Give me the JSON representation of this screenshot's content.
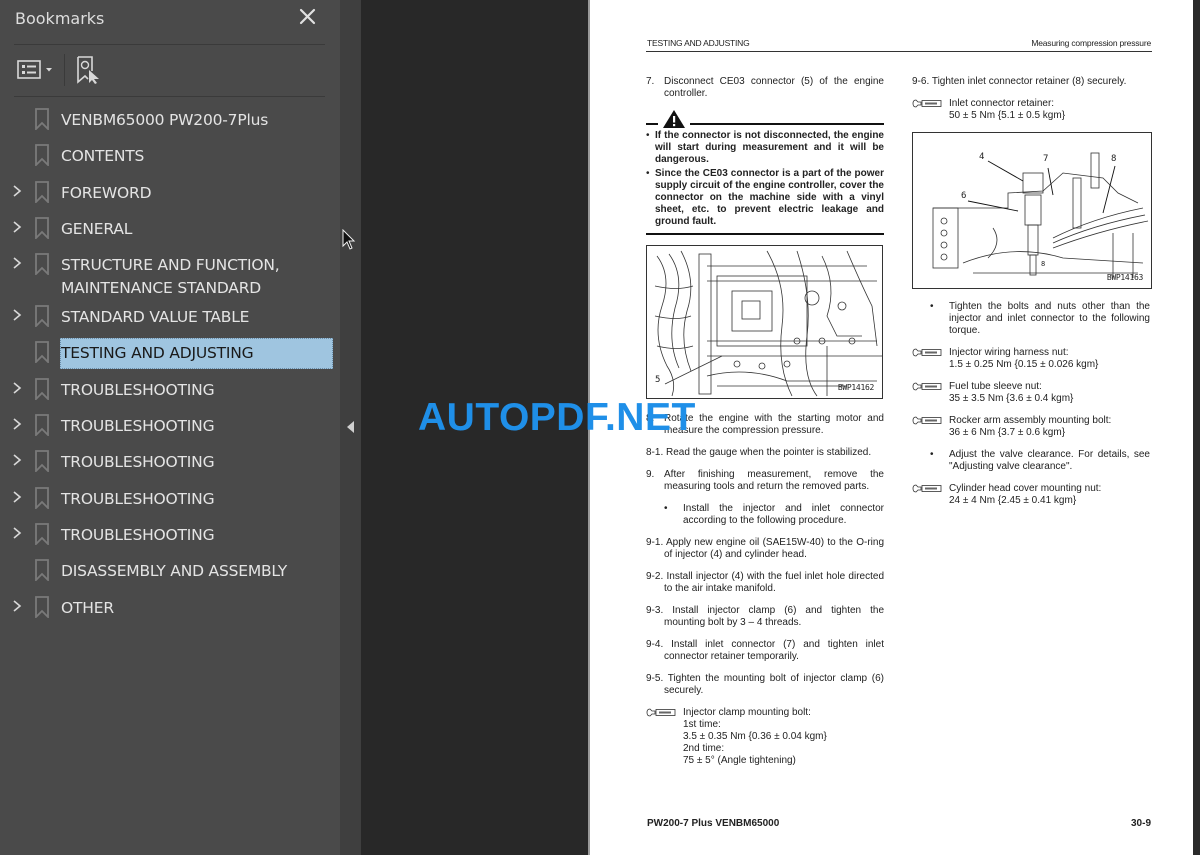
{
  "sidebar": {
    "title": "Bookmarks",
    "close_icon": "close-icon",
    "tools": {
      "options_icon": "list-options-icon",
      "find_icon": "find-current-bookmark-icon"
    },
    "items": [
      {
        "label": "VENBM65000 PW200-7Plus",
        "expandable": false,
        "selected": false
      },
      {
        "label": "CONTENTS",
        "expandable": false,
        "selected": false
      },
      {
        "label": "FOREWORD",
        "expandable": true,
        "selected": false
      },
      {
        "label": "GENERAL",
        "expandable": true,
        "selected": false
      },
      {
        "label": "STRUCTURE AND FUNCTION,",
        "label2": "MAINTENANCE STANDARD",
        "expandable": true,
        "selected": false
      },
      {
        "label": "STANDARD VALUE TABLE",
        "expandable": true,
        "selected": false
      },
      {
        "label": "TESTING AND ADJUSTING",
        "expandable": false,
        "selected": true
      },
      {
        "label": "TROUBLESHOOTING",
        "expandable": true,
        "selected": false
      },
      {
        "label": "TROUBLESHOOTING",
        "expandable": true,
        "selected": false
      },
      {
        "label": "TROUBLESHOOTING",
        "expandable": true,
        "selected": false
      },
      {
        "label": "TROUBLESHOOTING",
        "expandable": true,
        "selected": false
      },
      {
        "label": "TROUBLESHOOTING",
        "expandable": true,
        "selected": false
      },
      {
        "label": "DISASSEMBLY AND ASSEMBLY",
        "expandable": false,
        "selected": false
      },
      {
        "label": "OTHER",
        "expandable": true,
        "selected": false
      }
    ]
  },
  "watermark": "AUTOPDF.NET",
  "page": {
    "header_left": "TESTING AND ADJUSTING",
    "header_right": "Measuring compression pressure",
    "left": {
      "step7_num": "7.",
      "step7_text": "Disconnect CE03 connector (5) of the engine controller.",
      "warning": [
        "If the connector is not disconnected, the engine will start during measurement and it will be dangerous.",
        "Since the CE03 connector is a part of the power supply circuit of the engine controller, cover the connector on the machine side with a vinyl sheet, etc. to prevent electric leakage and ground fault."
      ],
      "figure1": {
        "code": "BWP14162",
        "callout": "5"
      },
      "step8_num": "8.",
      "step8_text": "Rotate the engine with the starting motor and measure the compression pressure.",
      "step8_1": "8-1. Read the gauge when the pointer is stabilized.",
      "step9_num": "9.",
      "step9_text": "After finishing measurement, remove the measuring tools and return the removed parts.",
      "step9_bullet": "Install the injector and inlet connector according to the following procedure.",
      "step9_1": "9-1. Apply new engine oil (SAE15W-40) to the O-ring of injector (4) and cylinder head.",
      "step9_2": "9-2. Install injector (4) with the fuel inlet hole directed to the air intake manifold.",
      "step9_3": "9-3. Install injector clamp (6) and tighten the mounting bolt by 3 – 4 threads.",
      "step9_4": "9-4. Install inlet connector (7) and tighten inlet connector retainer temporarily.",
      "step9_5": "9-5. Tighten the mounting bolt of injector clamp (6) securely.",
      "torque1": {
        "title": "Injector clamp mounting bolt:",
        "line1": "1st time:",
        "line2": "3.5 ± 0.35 Nm {0.36 ± 0.04 kgm}",
        "line3": "2nd time:",
        "line4": "75 ± 5° (Angle tightening)"
      }
    },
    "right": {
      "step9_6": "9-6. Tighten inlet connector retainer (8) securely.",
      "torque_inlet": {
        "title": "Inlet connector retainer:",
        "value": "50 ± 5 Nm {5.1 ± 0.5 kgm}"
      },
      "figure2": {
        "code": "BWP14163",
        "callouts": [
          "4",
          "7",
          "8",
          "6",
          "8"
        ]
      },
      "bullet1": "Tighten the bolts and nuts other than the injector and inlet connector to the following torque.",
      "torque_harness": {
        "title": "Injector wiring harness nut:",
        "value": "1.5 ± 0.25 Nm {0.15 ± 0.026 kgm}"
      },
      "torque_fuel": {
        "title": "Fuel tube sleeve nut:",
        "value": "35 ± 3.5 Nm {3.6 ± 0.4 kgm}"
      },
      "torque_rocker": {
        "title": "Rocker arm assembly mounting bolt:",
        "value": "36 ± 6 Nm {3.7 ± 0.6 kgm}"
      },
      "bullet2": "Adjust the valve clearance. For details, see \"Adjusting valve clearance\".",
      "torque_cover": {
        "title": "Cylinder head cover mounting nut:",
        "value": "24 ± 4 Nm {2.45 ± 0.41 kgm}"
      }
    },
    "footer_left": "PW200-7 Plus  VENBM65000",
    "footer_right": "30-9"
  }
}
